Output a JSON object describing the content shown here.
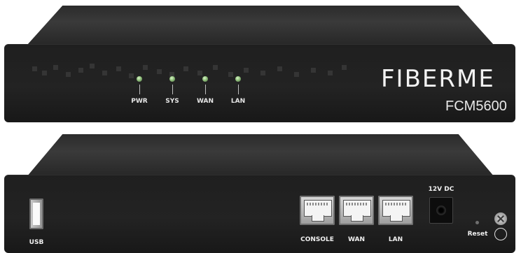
{
  "front": {
    "brand": "FIBERME",
    "model": "FCM5600",
    "leds": [
      {
        "label": "PWR"
      },
      {
        "label": "SYS"
      },
      {
        "label": "WAN"
      },
      {
        "label": "LAN"
      }
    ]
  },
  "rear": {
    "usb_label": "USB",
    "ports": [
      {
        "label": "CONSOLE"
      },
      {
        "label": "WAN"
      },
      {
        "label": "LAN"
      }
    ],
    "dc_label": "12V DC",
    "reset_label": "Reset"
  }
}
